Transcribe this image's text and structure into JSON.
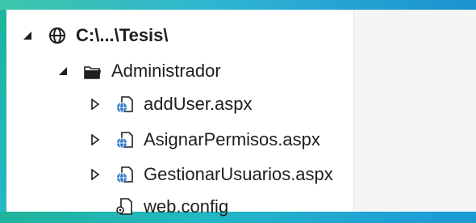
{
  "solution_explorer": {
    "root": {
      "label": "C:\\...\\Tesis\\",
      "icon": "globe-icon",
      "expanded": true
    },
    "folder": {
      "label": "Administrador",
      "icon": "folder-open-icon",
      "expanded": true
    },
    "files": [
      {
        "label": "addUser.aspx",
        "icon": "aspx-web-page-icon",
        "collapsed": true
      },
      {
        "label": "AsignarPermisos.aspx",
        "icon": "aspx-web-page-icon",
        "collapsed": true
      },
      {
        "label": "GestionarUsuarios.aspx",
        "icon": "aspx-web-page-icon",
        "collapsed": true
      },
      {
        "label": "web.config",
        "icon": "config-file-icon",
        "collapsed": false
      }
    ]
  },
  "colors": {
    "background_gradient": [
      "#1fb39a",
      "#23b8c4",
      "#1f9fd6",
      "#0f8cc9"
    ],
    "panel": "#ffffff",
    "text": "#1e1e1e",
    "globe_blue": "#2a74c9"
  }
}
